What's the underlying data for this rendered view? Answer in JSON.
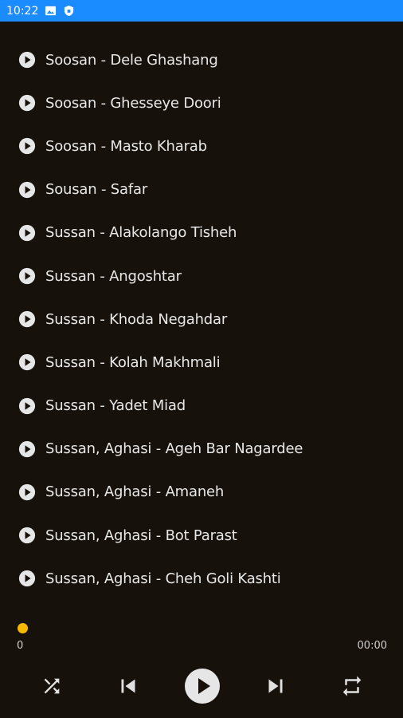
{
  "status_bar": {
    "time": "10:22",
    "background": "#1a8cff",
    "icons": [
      "image-icon",
      "shield-icon"
    ]
  },
  "playlist": {
    "items": [
      {
        "title": "Soosan - Dele Ghashang"
      },
      {
        "title": "Soosan - Ghesseye Doori"
      },
      {
        "title": "Soosan - Masto Kharab"
      },
      {
        "title": "Sousan - Safar"
      },
      {
        "title": "Sussan - Alakolango Tisheh"
      },
      {
        "title": "Sussan - Angoshtar"
      },
      {
        "title": "Sussan - Khoda Negahdar"
      },
      {
        "title": "Sussan - Kolah Makhmali"
      },
      {
        "title": "Sussan - Yadet Miad"
      },
      {
        "title": "Sussan, Aghasi - Ageh Bar Nagardee"
      },
      {
        "title": "Sussan, Aghasi - Amaneh"
      },
      {
        "title": "Sussan, Aghasi - Bot Parast"
      },
      {
        "title": "Sussan, Aghasi - Cheh Goli Kashti"
      }
    ]
  },
  "player": {
    "elapsed": "0",
    "duration": "00:00",
    "progress": 0,
    "accent": "#f6b800",
    "controls": [
      "shuffle-icon",
      "previous-icon",
      "play-icon",
      "next-icon",
      "repeat-icon"
    ]
  },
  "colors": {
    "background": "#16120b",
    "text": "#e8e8e8"
  }
}
